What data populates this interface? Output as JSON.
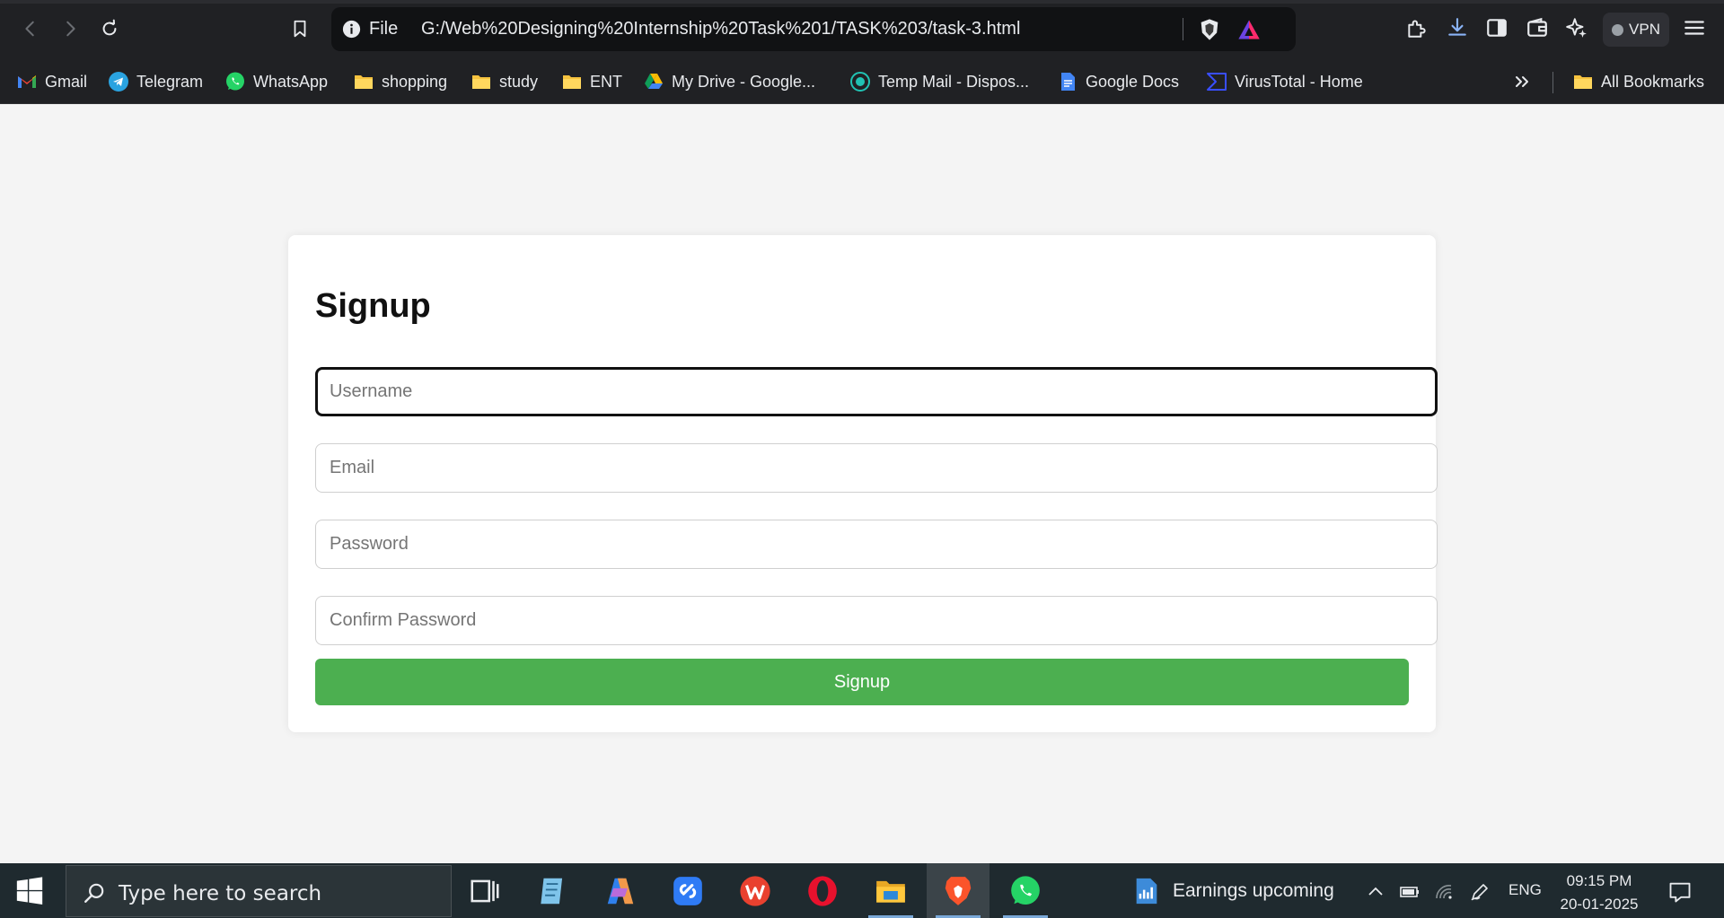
{
  "browser": {
    "url_scheme": "File",
    "url": "G:/Web%20Designing%20Internship%20Task%201/TASK%203/task-3.html",
    "vpn_label": "VPN",
    "icons": [
      "back-icon",
      "forward-icon",
      "reload-icon",
      "bookmark-icon",
      "info-icon",
      "brave-shields-icon",
      "brave-rewards-icon",
      "extensions-icon",
      "download-icon",
      "sidebar-icon",
      "wallet-icon",
      "leo-ai-icon",
      "menu-icon"
    ]
  },
  "bookmarks": {
    "items": [
      {
        "label": "Gmail",
        "icon": "gmail-icon"
      },
      {
        "label": "Telegram",
        "icon": "telegram-icon"
      },
      {
        "label": "WhatsApp",
        "icon": "whatsapp-icon"
      },
      {
        "label": "shopping",
        "icon": "folder-icon"
      },
      {
        "label": "study",
        "icon": "folder-icon"
      },
      {
        "label": "ENT",
        "icon": "folder-icon"
      },
      {
        "label": "My Drive - Google...",
        "icon": "google-drive-icon"
      },
      {
        "label": "Temp Mail - Dispos...",
        "icon": "temp-mail-icon"
      },
      {
        "label": "Google Docs",
        "icon": "google-docs-icon"
      },
      {
        "label": "VirusTotal - Home",
        "icon": "virustotal-icon"
      }
    ],
    "all_bookmarks": "All Bookmarks"
  },
  "signup": {
    "title": "Signup",
    "username_placeholder": "Username",
    "email_placeholder": "Email",
    "password_placeholder": "Password",
    "confirm_placeholder": "Confirm Password",
    "submit_label": "Signup",
    "accent": "#4caf50"
  },
  "taskbar": {
    "search_placeholder": "Type here to search",
    "news_text": "Earnings upcoming",
    "language": "ENG",
    "time": "09:15 PM",
    "date": "20-01-2025"
  }
}
